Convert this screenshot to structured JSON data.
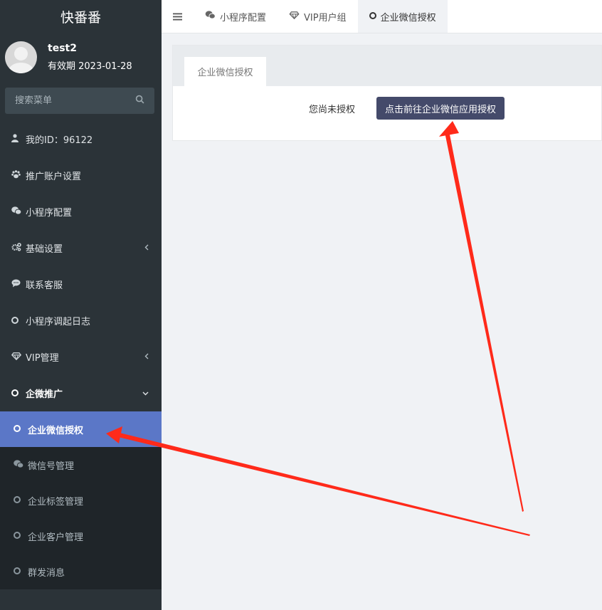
{
  "brand": "快番番",
  "user": {
    "name": "test2",
    "expire": "有效期 2023-01-28"
  },
  "search": {
    "placeholder": "搜索菜单",
    "icon": "search-icon"
  },
  "menu": [
    {
      "icon": "user-icon",
      "label": "我的ID：96122"
    },
    {
      "icon": "paw-icon",
      "label": "推广账户设置"
    },
    {
      "icon": "wechat-icon",
      "label": "小程序配置"
    },
    {
      "icon": "cogs-icon",
      "label": "基础设置"
    },
    {
      "icon": "comment-icon",
      "label": "联系客服"
    },
    {
      "icon": "circle-icon",
      "label": "小程序调起日志"
    },
    {
      "icon": "diamond-icon",
      "label": "VIP管理"
    },
    {
      "icon": "circle-icon",
      "label": "企微推广"
    }
  ],
  "submenu": [
    {
      "icon": "circle-icon",
      "label": "企业微信授权"
    },
    {
      "icon": "wechat-icon",
      "label": "微信号管理"
    },
    {
      "icon": "circle-icon",
      "label": "企业标签管理"
    },
    {
      "icon": "circle-icon",
      "label": "企业客户管理"
    },
    {
      "icon": "circle-icon",
      "label": "群发消息"
    }
  ],
  "tabs": [
    {
      "icon": "wechat-icon",
      "label": "小程序配置"
    },
    {
      "icon": "diamond-icon",
      "label": "VIP用户组"
    },
    {
      "icon": "circle-icon",
      "label": "企业微信授权"
    }
  ],
  "panel": {
    "tab": "企业微信授权",
    "status": "您尚未授权",
    "button": "点击前往企业微信应用授权"
  },
  "colors": {
    "sidebar": "#2b3338",
    "submenu": "#1f2529",
    "active": "#5b77c7",
    "button": "#444a6a",
    "arrow": "#ff2a1a"
  }
}
